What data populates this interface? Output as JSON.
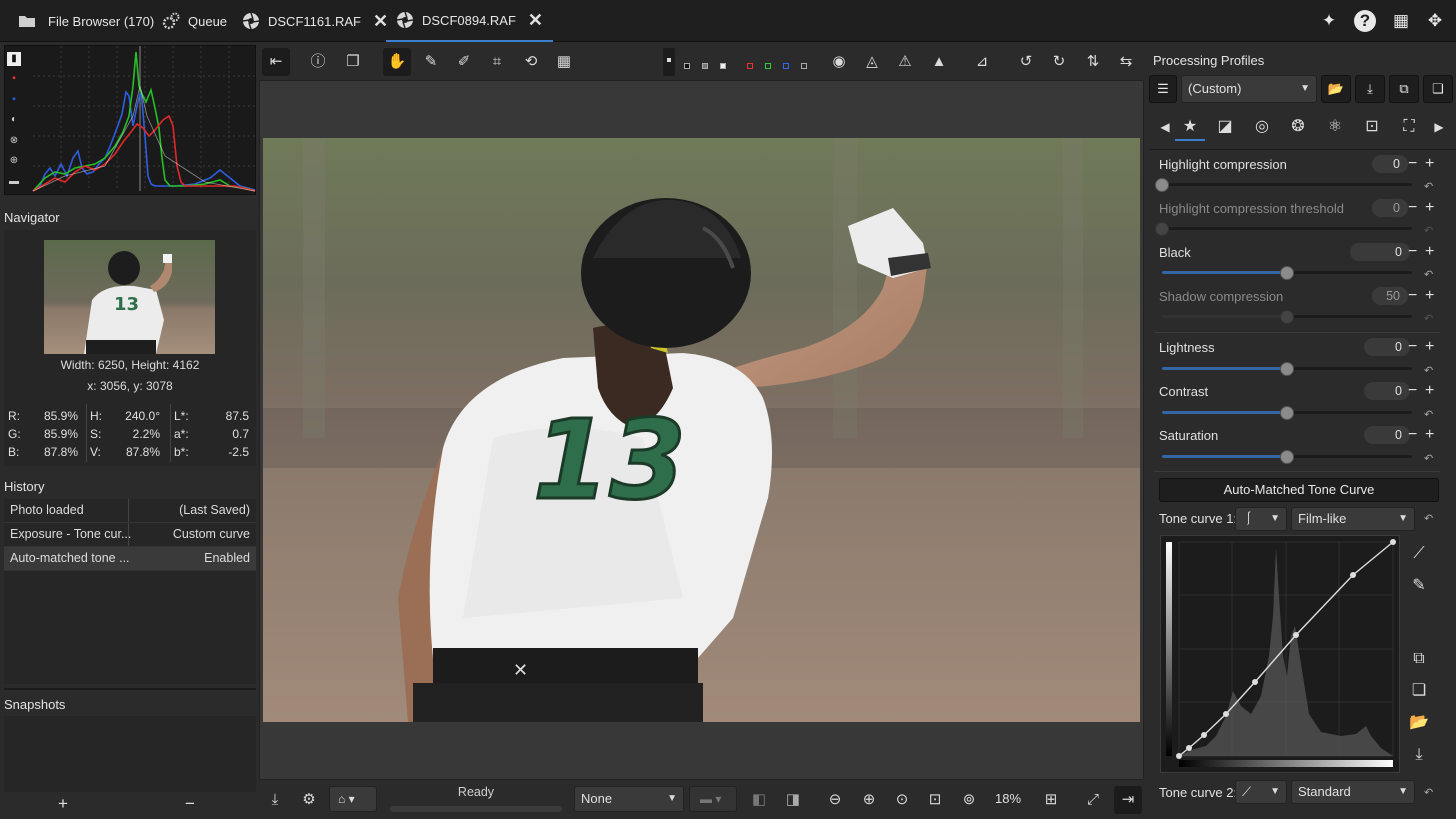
{
  "tabs": [
    {
      "label": "File Browser (170)",
      "icon": "folder-icon"
    },
    {
      "label": "Queue",
      "icon": "gears-icon"
    },
    {
      "label": "DSCF1161.RAF",
      "icon": "aperture-icon",
      "close": "✕"
    },
    {
      "label": "DSCF0894.RAF",
      "icon": "aperture-icon",
      "close": "✕"
    }
  ],
  "accent": "#3b7fd1",
  "navigator": {
    "title": "Navigator",
    "dimensions": "Width: 6250, Height: 4162",
    "coords": "x: 3056, y: 3078",
    "rgb": {
      "r_label": "R:",
      "r": "85.9%",
      "g_label": "G:",
      "g": "85.9%",
      "b_label": "B:",
      "b": "87.8%"
    },
    "hsv": {
      "h_label": "H:",
      "h": "240.0°",
      "s_label": "S:",
      "s": "2.2%",
      "v_label": "V:",
      "v": "87.8%"
    },
    "lab": {
      "l_label": "L*:",
      "l": "87.5",
      "a_label": "a*:",
      "a": "0.7",
      "b_label": "b*:",
      "b": "-2.5"
    }
  },
  "history": {
    "title": "History",
    "rows": [
      {
        "action": "Photo loaded",
        "value": "(Last Saved)"
      },
      {
        "action": "Exposure - Tone cur...",
        "value": "Custom curve"
      },
      {
        "action": "Auto-matched tone ...",
        "value": "Enabled"
      }
    ]
  },
  "snapshots": {
    "title": "Snapshots",
    "add": "+",
    "remove": "−"
  },
  "photo": {
    "jersey_number": "13"
  },
  "statusbar": {
    "status": "Ready",
    "preset": "None",
    "zoom": "18%"
  },
  "processing": {
    "title": "Processing Profiles",
    "profile": "(Custom)"
  },
  "sliders": [
    {
      "label": "Highlight compression",
      "value": "0",
      "dim": false,
      "level": 0
    },
    {
      "label": "Highlight compression threshold",
      "value": "0",
      "dim": true,
      "level": 0
    },
    {
      "label": "Black",
      "value": "0",
      "dim": false,
      "level": 0.5
    },
    {
      "label": "Shadow compression",
      "value": "50",
      "dim": true,
      "level": 0.5
    },
    {
      "label": "Lightness",
      "value": "0",
      "dim": false,
      "level": 0.5
    },
    {
      "label": "Contrast",
      "value": "0",
      "dim": false,
      "level": 0.5
    },
    {
      "label": "Saturation",
      "value": "0",
      "dim": false,
      "level": 0.5
    }
  ],
  "tone": {
    "auto_button": "Auto-Matched Tone Curve",
    "curve1_label": "Tone curve 1:",
    "curve1_mode": "Film-like",
    "curve2_label": "Tone curve 2:",
    "curve2_mode": "Standard"
  }
}
